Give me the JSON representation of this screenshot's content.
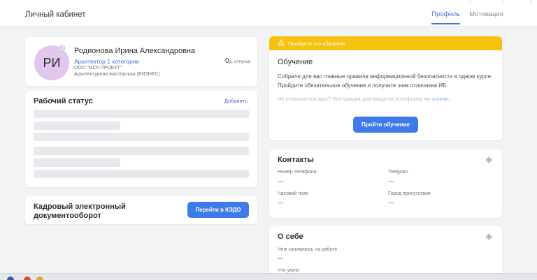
{
  "header": {
    "title": "Личный кабинет",
    "tabs": [
      {
        "label": "Профиль",
        "active": true
      },
      {
        "label": "Мотивация",
        "active": false
      }
    ]
  },
  "profile": {
    "initials": "РИ",
    "name": "Родионова Ирина Александровна",
    "position": "Архитектор 1 категории",
    "organization": "ООО \"МСК ПРОЕКТ\"",
    "department": "Архитектурная мастерская (БИЗНЕС)",
    "vacation_days": "0",
    "vacation_unit": "д. отпуска"
  },
  "work_status": {
    "title": "Рабочий статус",
    "add_label": "Добавить"
  },
  "kedo": {
    "title_line1": "Кадровый электронный",
    "title_line2": "документооборот",
    "button_label": "Перейти в КЭДО"
  },
  "training": {
    "banner": "Пройдите это обучение",
    "title": "Обучение",
    "text": "Собрали для вас главные правила информационной безопасности в одном курсе. Пройдите обязательное обучение и получите знак отличника ИБ.",
    "hint": "Не открывается курс? Инструкция для входа на платформу",
    "hint_link": "по ссылке.",
    "button_label": "Пройти обучение"
  },
  "contacts": {
    "title": "Контакты",
    "fields": [
      {
        "label": "Номер телефона",
        "value": "—"
      },
      {
        "label": "Telegram",
        "value": "—"
      },
      {
        "label": "Часовой пояс",
        "value": "—"
      },
      {
        "label": "Город присутствия",
        "value": "—"
      }
    ]
  },
  "about": {
    "title": "О себе",
    "fields": [
      {
        "label": "Чем занимаюсь на работе",
        "value": "—"
      },
      {
        "label": "Что умею",
        "value": ""
      }
    ]
  },
  "colors": {
    "accent": "#3e7ae8",
    "banner": "#f6c20e",
    "avatar": "#e1c6ee"
  }
}
